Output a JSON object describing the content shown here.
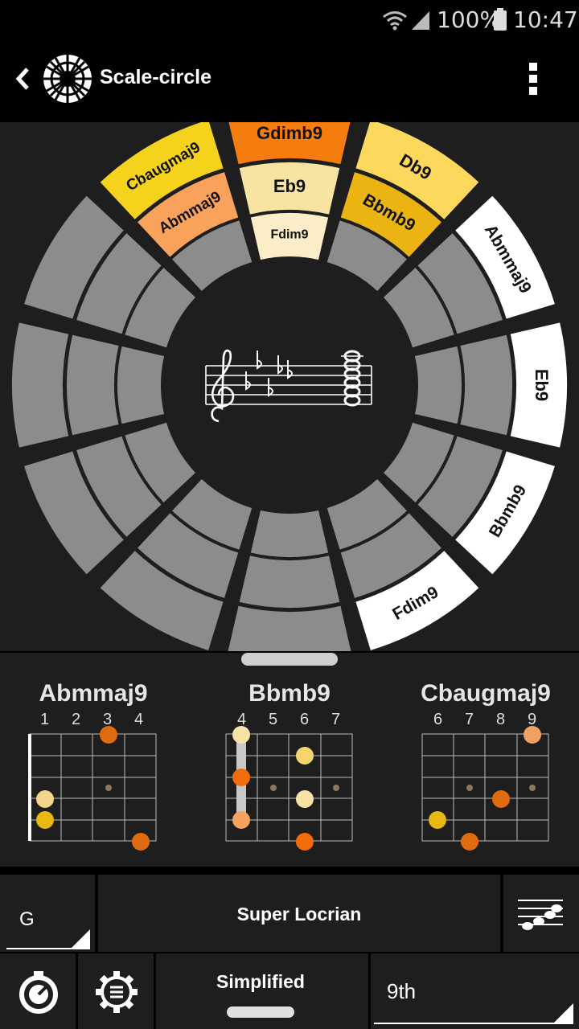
{
  "status": {
    "battery": "100%",
    "time": "10:47"
  },
  "appbar": {
    "title": "Scale-circle"
  },
  "circle": {
    "center_text": "",
    "highlighted": [
      {
        "label": "Cbaugmaj9",
        "color": "#f5d21c"
      },
      {
        "label": "Gdimb9",
        "color": "#f77c0e"
      },
      {
        "label": "Db9",
        "color": "#fcd95c"
      },
      {
        "label": "Abmmaj9",
        "color": "#f9a25b"
      },
      {
        "label": "Eb9",
        "color": "#f8e4a2"
      },
      {
        "label": "Bbmb9",
        "color": "#ebb413"
      },
      {
        "label": "Fdim9",
        "color": "#faedc8"
      }
    ],
    "outer_right": [
      "Abmmaj9",
      "Eb9",
      "Bbmb9",
      "Fdim9"
    ]
  },
  "chords": [
    {
      "name": "Abmmaj9",
      "frets": [
        "1",
        "2",
        "3",
        "4"
      ]
    },
    {
      "name": "Bbmb9",
      "frets": [
        "4",
        "5",
        "6",
        "7"
      ]
    },
    {
      "name": "Cbaugmaj9",
      "frets": [
        "6",
        "7",
        "8",
        "9"
      ]
    }
  ],
  "bottom": {
    "key": "G",
    "scale": "Super Locrian",
    "mode": "Simplified",
    "extension": "9th"
  },
  "colors": {
    "accent_orange": "#f26d0a",
    "pale": "#f7dc9a",
    "gray_cell": "#8c8c8c",
    "bg": "#1e1e1e"
  }
}
